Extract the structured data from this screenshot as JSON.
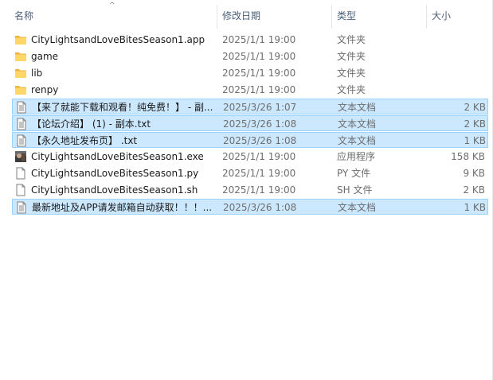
{
  "header": {
    "name": "名称",
    "date": "修改日期",
    "type": "类型",
    "size": "大小",
    "sort_indicator": "^"
  },
  "files": [
    {
      "name": "CityLightsandLoveBitesSeason1.app",
      "date": "2025/1/1 19:00",
      "type": "文件夹",
      "size": "",
      "icon": "folder-icon",
      "selected": false
    },
    {
      "name": "game",
      "date": "2025/1/1 19:00",
      "type": "文件夹",
      "size": "",
      "icon": "folder-icon",
      "selected": false
    },
    {
      "name": "lib",
      "date": "2025/1/1 19:00",
      "type": "文件夹",
      "size": "",
      "icon": "folder-icon",
      "selected": false
    },
    {
      "name": "renpy",
      "date": "2025/1/1 19:00",
      "type": "文件夹",
      "size": "",
      "icon": "folder-icon",
      "selected": false
    },
    {
      "name": "【来了就能下载和观看！纯免费！】 - 副...",
      "date": "2025/3/26 1:07",
      "type": "文本文档",
      "size": "2 KB",
      "icon": "text-document-icon",
      "selected": true
    },
    {
      "name": "【论坛介绍】 (1) - 副本.txt",
      "date": "2025/3/26 1:08",
      "type": "文本文档",
      "size": "2 KB",
      "icon": "text-document-icon",
      "selected": true
    },
    {
      "name": "【永久地址发布页】 .txt",
      "date": "2025/3/26 1:08",
      "type": "文本文档",
      "size": "1 KB",
      "icon": "text-document-icon",
      "selected": true
    },
    {
      "name": "CityLightsandLoveBitesSeason1.exe",
      "date": "2025/1/1 19:00",
      "type": "应用程序",
      "size": "158 KB",
      "icon": "app-exe-icon",
      "selected": false
    },
    {
      "name": "CityLightsandLoveBitesSeason1.py",
      "date": "2025/1/1 19:00",
      "type": "PY 文件",
      "size": "9 KB",
      "icon": "blank-file-icon",
      "selected": false
    },
    {
      "name": "CityLightsandLoveBitesSeason1.sh",
      "date": "2025/1/1 19:00",
      "type": "SH 文件",
      "size": "2 KB",
      "icon": "blank-file-icon",
      "selected": false
    },
    {
      "name": "最新地址及APP请发邮箱自动获取！！！...",
      "date": "2025/3/26 1:08",
      "type": "文本文档",
      "size": "1 KB",
      "icon": "text-document-icon",
      "selected": true
    }
  ],
  "colors": {
    "selection": "#cce8ff",
    "selection_border": "#99d1ff",
    "folder": "#ffd166",
    "header_text": "#4c607a"
  }
}
